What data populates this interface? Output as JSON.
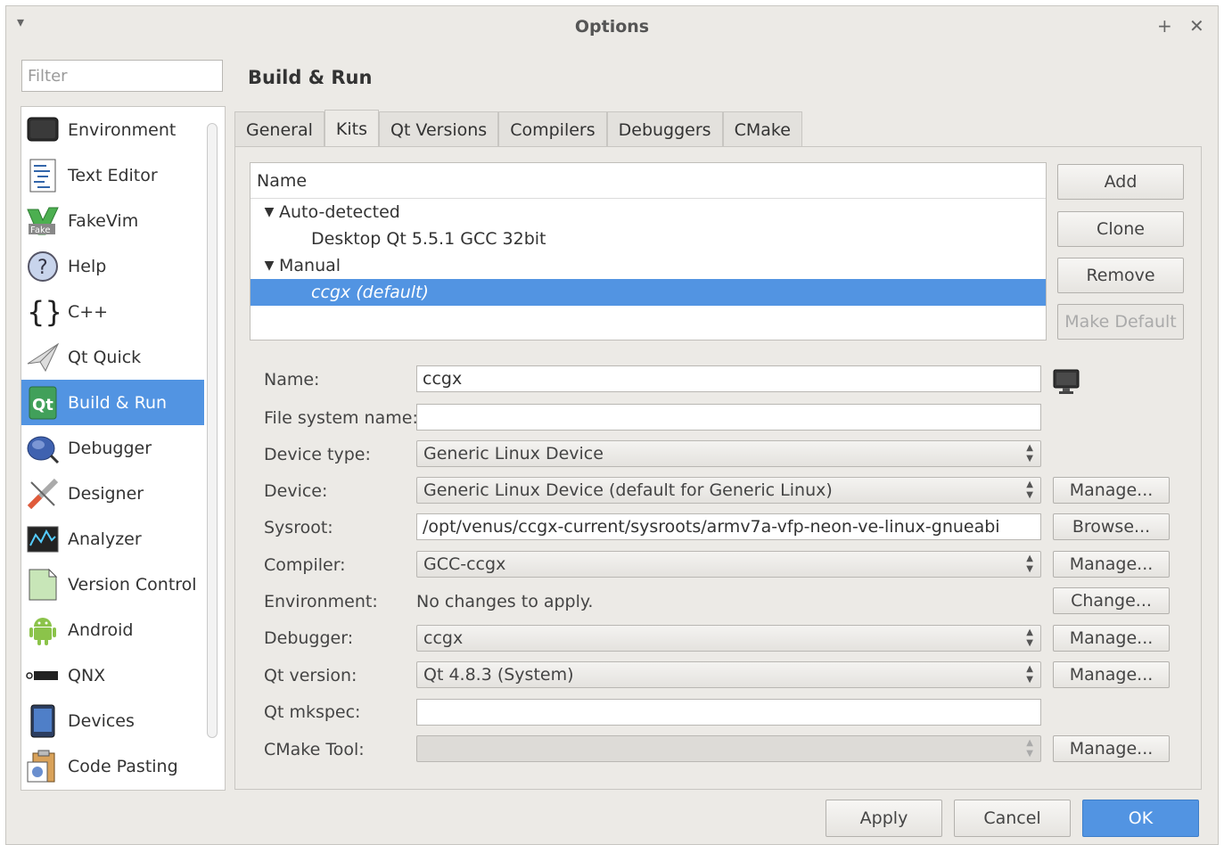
{
  "window": {
    "title": "Options"
  },
  "sidebar": {
    "filter_placeholder": "Filter",
    "items": [
      {
        "label": "Environment",
        "icon": "monitor-icon"
      },
      {
        "label": "Text Editor",
        "icon": "text-editor-icon"
      },
      {
        "label": "FakeVim",
        "icon": "fakevim-icon"
      },
      {
        "label": "Help",
        "icon": "help-icon"
      },
      {
        "label": "C++",
        "icon": "braces-icon"
      },
      {
        "label": "Qt Quick",
        "icon": "paper-plane-icon"
      },
      {
        "label": "Build & Run",
        "icon": "qt-build-icon",
        "selected": true
      },
      {
        "label": "Debugger",
        "icon": "bug-icon"
      },
      {
        "label": "Designer",
        "icon": "designer-icon"
      },
      {
        "label": "Analyzer",
        "icon": "analyzer-icon"
      },
      {
        "label": "Version Control",
        "icon": "document-icon"
      },
      {
        "label": "Android",
        "icon": "android-icon"
      },
      {
        "label": "QNX",
        "icon": "qnx-logo-icon"
      },
      {
        "label": "Devices",
        "icon": "tablet-icon"
      },
      {
        "label": "Code Pasting",
        "icon": "code-pasting-icon"
      }
    ]
  },
  "main": {
    "title": "Build & Run",
    "tabs": [
      "General",
      "Kits",
      "Qt Versions",
      "Compilers",
      "Debuggers",
      "CMake"
    ],
    "active_tab": 1,
    "kits_tree": {
      "header": "Name",
      "groups": [
        {
          "label": "Auto-detected",
          "children": [
            "Desktop Qt 5.5.1 GCC 32bit"
          ]
        },
        {
          "label": "Manual",
          "children": [
            "ccgx (default)"
          ]
        }
      ]
    },
    "buttons": {
      "add": "Add",
      "clone": "Clone",
      "remove": "Remove",
      "make_default": "Make Default"
    },
    "form": {
      "name": {
        "label": "Name:",
        "value": "ccgx"
      },
      "fs_name": {
        "label": "File system name:",
        "value": ""
      },
      "device_type": {
        "label": "Device type:",
        "value": "Generic Linux Device"
      },
      "device": {
        "label": "Device:",
        "value": "Generic Linux Device (default for Generic Linux)",
        "button": "Manage..."
      },
      "sysroot": {
        "label": "Sysroot:",
        "value": "/opt/venus/ccgx-current/sysroots/armv7a-vfp-neon-ve-linux-gnueabi",
        "button": "Browse..."
      },
      "compiler": {
        "label": "Compiler:",
        "value": "GCC-ccgx",
        "button": "Manage..."
      },
      "environment": {
        "label": "Environment:",
        "value": "No changes to apply.",
        "button": "Change..."
      },
      "debugger": {
        "label": "Debugger:",
        "value": "ccgx",
        "button": "Manage..."
      },
      "qt_version": {
        "label": "Qt version:",
        "value": "Qt 4.8.3 (System)",
        "button": "Manage..."
      },
      "qt_mkspec": {
        "label": "Qt mkspec:",
        "value": ""
      },
      "cmake_tool": {
        "label": "CMake Tool:",
        "value": "",
        "button": "Manage..."
      }
    }
  },
  "footer": {
    "apply": "Apply",
    "cancel": "Cancel",
    "ok": "OK"
  },
  "colors": {
    "accent": "#5294e2",
    "background": "#eceae6"
  }
}
